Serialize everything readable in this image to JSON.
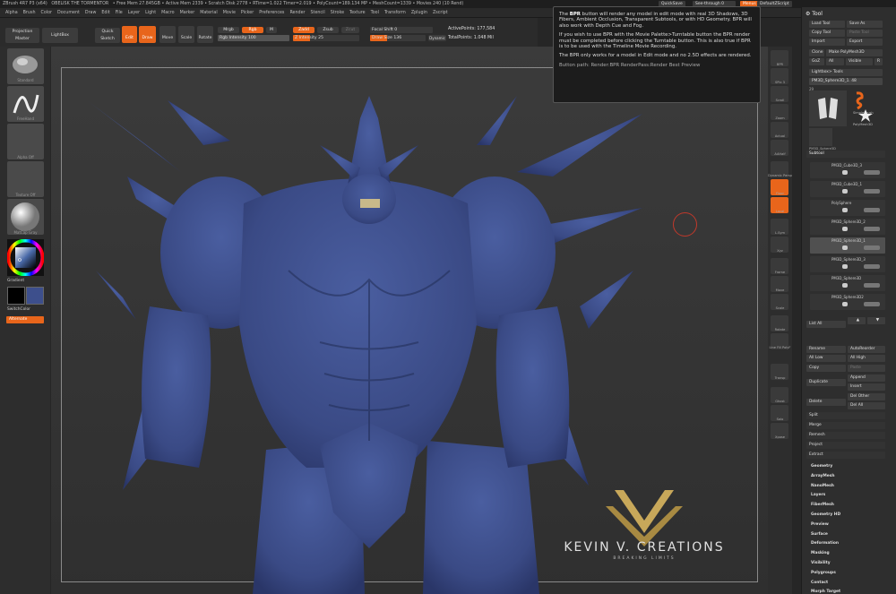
{
  "titlebar": {
    "app": "ZBrush 4R7 P3 (x64)",
    "doc": "OBELISK THE TORMENTOR",
    "stats": "• Free Mem 27.845GB • Active Mem 2339 • Scratch Disk 2778 • RTime=1.022 Timer=2.019 • PolyCount=189.134 MP • MeshCount=1339 • Movies 240 (10 Rend)"
  },
  "menubar": {
    "items": [
      "Alpha",
      "Brush",
      "Color",
      "Document",
      "Draw",
      "Edit",
      "File",
      "Layer",
      "Light",
      "Macro",
      "Marker",
      "Material",
      "Movie",
      "Picker",
      "Preferences",
      "Render",
      "Stencil",
      "Stroke",
      "Texture",
      "Tool",
      "Transform",
      "Zplugin",
      "Zscript"
    ],
    "quicksave": "QuickSave",
    "seethrough": "See-through 0",
    "menus": "Menus",
    "defaultscript": "DefaultZScript"
  },
  "toolbar": {
    "projection_master": "Projection Master",
    "lightbox": "LightBox",
    "quick_sketch": "Quick Sketch",
    "edit": "Edit",
    "draw": "Draw",
    "move": "Move",
    "scale": "Scale",
    "rotate": "Rotate",
    "mrgb": "Mrgb",
    "rgb": "Rgb",
    "m": "M",
    "zadd": "Zadd",
    "zsub": "Zsub",
    "zcut": "Zcut",
    "rgb_intensity_label": "Rgb Intensity",
    "rgb_intensity": "100",
    "z_intensity_label": "Z Intensity",
    "z_intensity": "25",
    "focal_shift_label": "Focal Shift",
    "focal_shift": "0",
    "draw_size_label": "Draw Size",
    "draw_size": "136",
    "dynamic": "Dynamic",
    "active_points_label": "ActivePoints:",
    "active_points": "177,584",
    "total_points_label": "TotalPoints:",
    "total_points": "1.048 Mil"
  },
  "lefttray": {
    "brush_label": "Standard",
    "stroke_label": "FreeHand",
    "alpha_label": "Alpha Off",
    "texture_label": "Texture Off",
    "material_label": "MatCap Gray",
    "gradient": "Gradient",
    "switchcolor": "SwitchColor",
    "alternate": "Alternate"
  },
  "righttray": {
    "labels": [
      "BPR",
      "SPix 3",
      "Scroll",
      "Zoom",
      "Actual",
      "AAHalf",
      "Dynamic Persp",
      "Floor",
      "Local",
      "L.Sym",
      "Xyz",
      "Frame",
      "Move",
      "Scale",
      "Rotate",
      "Line Fill PolyF",
      "Transp",
      "Ghost",
      "Solo",
      "Xpose"
    ]
  },
  "toolpanel": {
    "title": "Tool",
    "load_tool": "Load Tool",
    "save_as": "Save As",
    "copy_tool": "Copy Tool",
    "paste_tool": "Paste Tool",
    "import": "Import",
    "export": "Export",
    "clone": "Clone",
    "make_polymesh": "Make PolyMesh3D",
    "goz": "GoZ",
    "all": "All",
    "visible": "Visible",
    "r": "R",
    "lightbox_tools": "Lightbox> Tools",
    "current_tool": "PM3D_Sphere3D_1. 48",
    "tool_count": "29",
    "simplebrush": "SimpleBrush",
    "polymesh3d": "PolyMesh3D",
    "tool_thumb_label": "PM3D_Sphere3D",
    "subtool_title": "Subtool",
    "subtools": [
      "PM3D_Cube3D_3",
      "PM3D_Cube3D_1",
      "PolySphere",
      "PM3D_Sphere3D_2",
      "PM3D_Sphere3D_1",
      "PM3D_Sphere3D_3",
      "PM3D_Sphere3D",
      "PM3D_Sphere3D2"
    ],
    "list_all": "List All",
    "rename": "Rename",
    "autoreorder": "AutoReorder",
    "all_low": "All Low",
    "all_high": "All High",
    "copy": "Copy",
    "paste": "Paste",
    "duplicate": "Duplicate",
    "append": "Append",
    "insert": "Insert",
    "delete": "Delete",
    "del_other": "Del Other",
    "del_all": "Del All",
    "split": "Split",
    "merge": "Merge",
    "remesh": "Remesh",
    "project": "Project",
    "extract": "Extract",
    "sections": [
      "Geometry",
      "ArrayMesh",
      "NanoMesh",
      "Layers",
      "FiberMesh",
      "Geometry HD",
      "Preview",
      "Surface",
      "Deformation",
      "Masking",
      "Visibility",
      "Polygroups",
      "Contact",
      "Morph Target"
    ]
  },
  "tooltip": {
    "p1_pre": "The ",
    "p1_bold": "BPR",
    "p1_post": " button will render any model in edit mode with real 3D Shadows, 3D Fibers, Ambient Occlusion, Transparent Subtools, or with HD Geometry. BPR will also work with Depth Cue and Fog.",
    "p2": "If you wish to use BPR with the Movie Palette>Turntable button the BPR render must be completed before clicking the Turntable button. This is also true if BPR is to be used with the Timeline Movie Recording.",
    "p3": "The BPR only works for a model in Edit mode and no 2.5D effects are rendered.",
    "p4": "Button path: Render:BPR RenderPass:Render Best Preview"
  },
  "watermark": {
    "brand": "KEVIN V. CREATIONS",
    "tagline": "BREAKING LIMITS"
  },
  "colors": {
    "accent": "#e8651b",
    "model": "#3d4f8c",
    "gold": "#c8a85a"
  }
}
